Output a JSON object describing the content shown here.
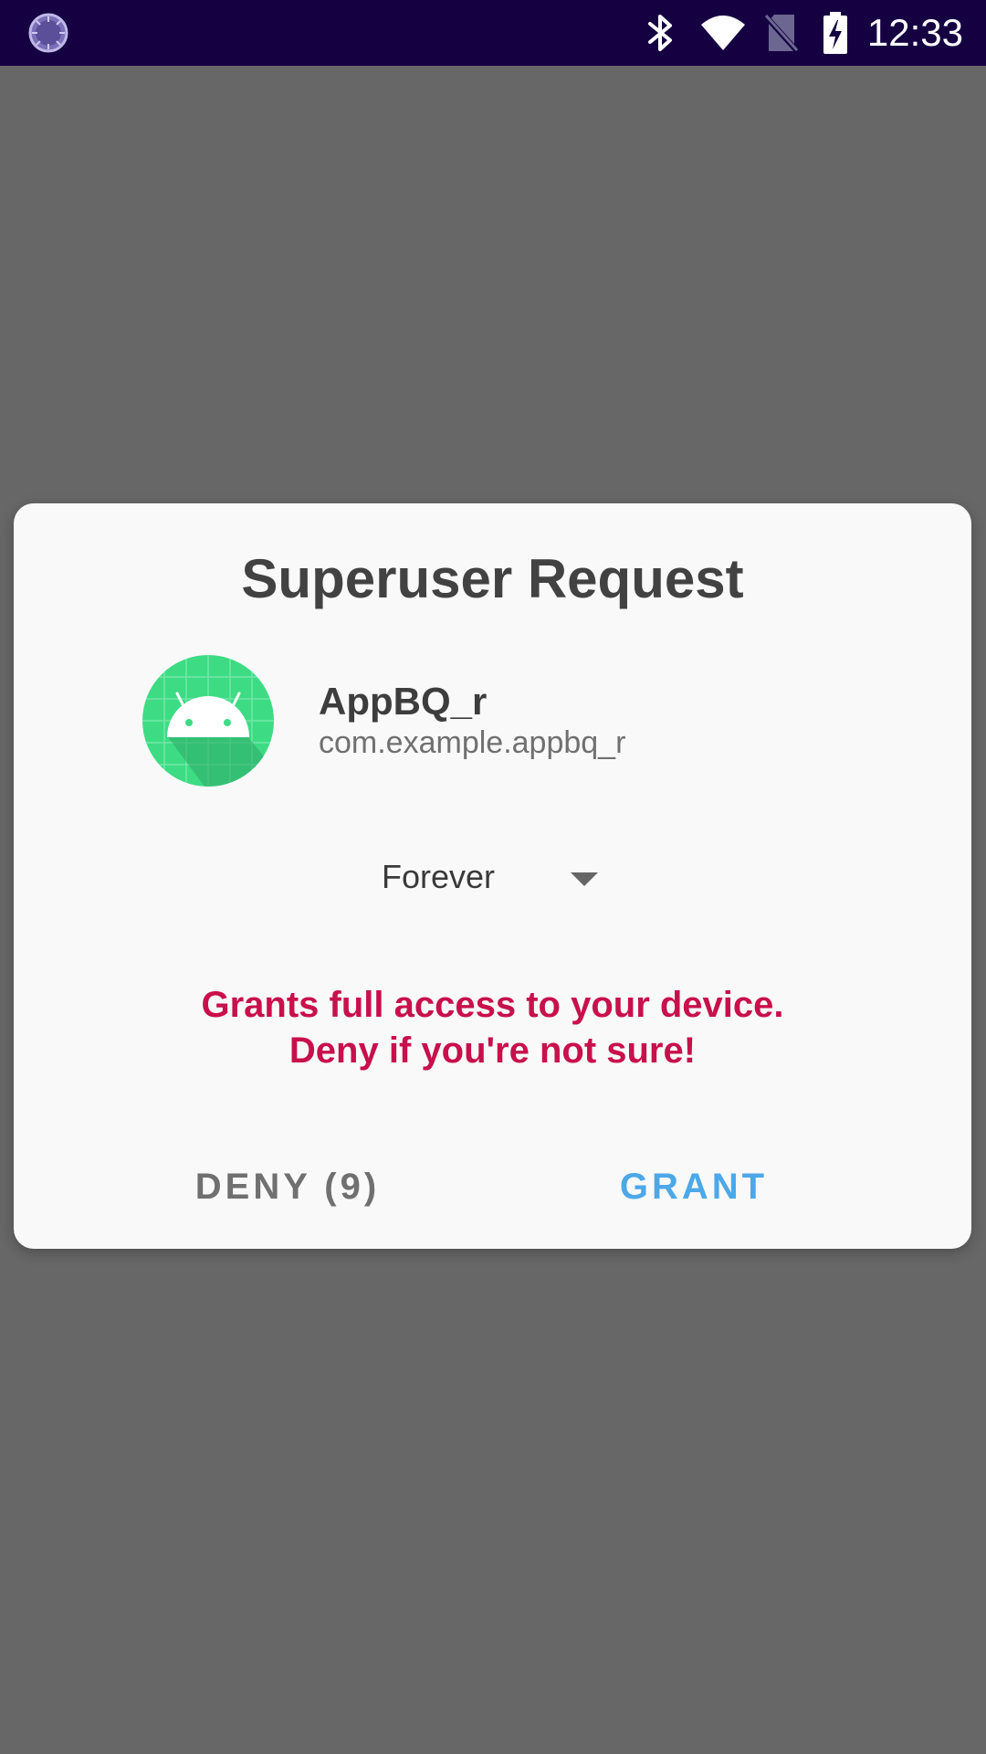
{
  "status_bar": {
    "time": "12:33",
    "icons": [
      "loading-circle-icon",
      "bluetooth-icon",
      "wifi-icon",
      "no-sim-icon",
      "battery-charging-icon"
    ]
  },
  "dialog": {
    "title": "Superuser Request",
    "app": {
      "icon": "android-app-icon",
      "name": "AppBQ_r",
      "package": "com.example.appbq_r"
    },
    "duration": {
      "selected": "Forever"
    },
    "warning": {
      "line1": "Grants full access to your device.",
      "line2": "Deny if you're not sure!"
    },
    "buttons": {
      "deny": "DENY (9)",
      "grant": "GRANT"
    }
  },
  "colors": {
    "status_bar_bg": "#150042",
    "scrim": "#676767",
    "dialog_bg": "#f9f9f9",
    "warning": "#c8104c",
    "grant": "#4da8e8",
    "deny": "#707070",
    "app_icon_green": "#3ddc84"
  }
}
